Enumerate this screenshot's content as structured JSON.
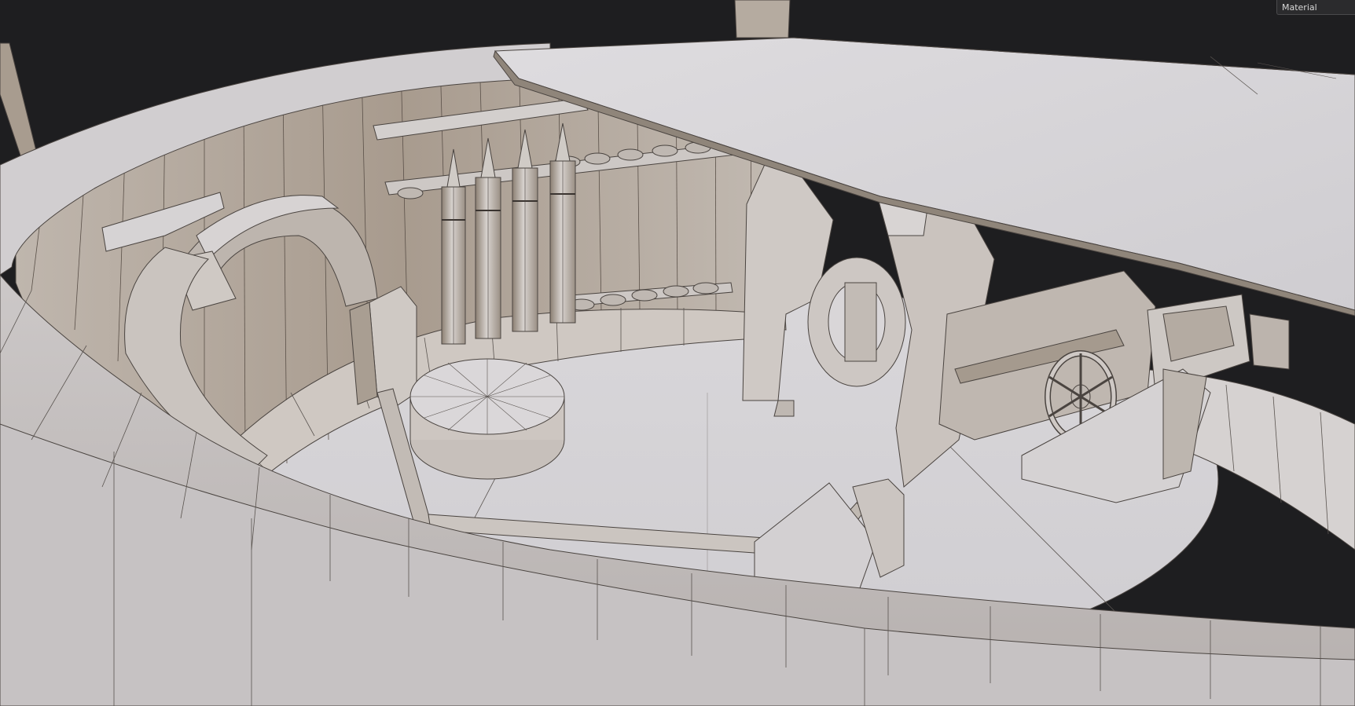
{
  "viewport": {
    "shading_mode_label": "Material",
    "background_color": "#1e1e20",
    "surface_color_light": "#d4d2d5",
    "surface_color_mid": "#b8b2ad",
    "surface_color_dark": "#8f857a",
    "wire_color": "#4a4440"
  }
}
